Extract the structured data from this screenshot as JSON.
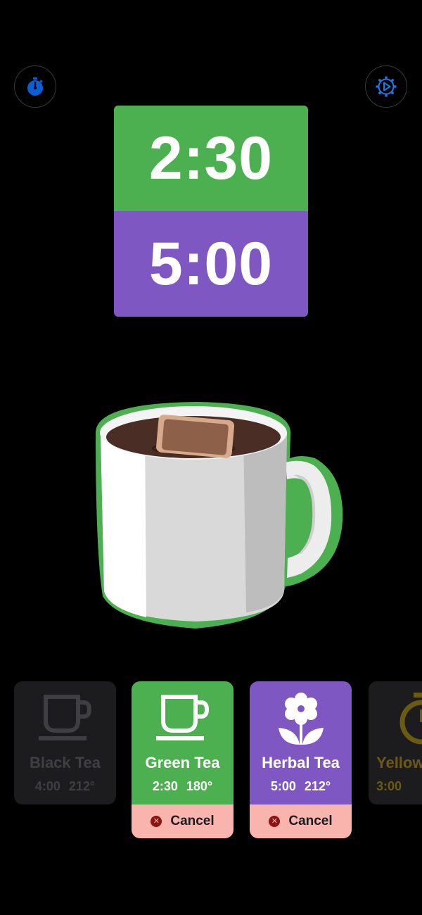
{
  "colors": {
    "background": "#000000",
    "green": "#4caf50",
    "purple": "#7e57c2",
    "card_dim": "#1c1c1e",
    "cancel_bg": "#f8b4ad",
    "accent_blue": "#0a84ff"
  },
  "toolbar": {
    "left_icon": "stopwatch-icon",
    "right_icon": "gear-play-icon"
  },
  "timers": [
    {
      "value": "2:30",
      "color": "#4caf50"
    },
    {
      "value": "5:00",
      "color": "#7e57c2"
    }
  ],
  "illustration": {
    "icon": "tea-mug-icon"
  },
  "teas": [
    {
      "name": "Black Tea",
      "time": "4:00",
      "temp": "212°",
      "icon": "cup-icon",
      "active": false
    },
    {
      "name": "Green Tea",
      "time": "2:30",
      "temp": "180°",
      "icon": "cup-icon",
      "active": true,
      "cancel_label": "Cancel"
    },
    {
      "name": "Herbal Tea",
      "time": "5:00",
      "temp": "212°",
      "icon": "flower-icon",
      "active": true,
      "cancel_label": "Cancel"
    },
    {
      "name": "Yellow",
      "time": "3:00",
      "temp": "",
      "icon": "timer-icon",
      "active": false
    }
  ]
}
